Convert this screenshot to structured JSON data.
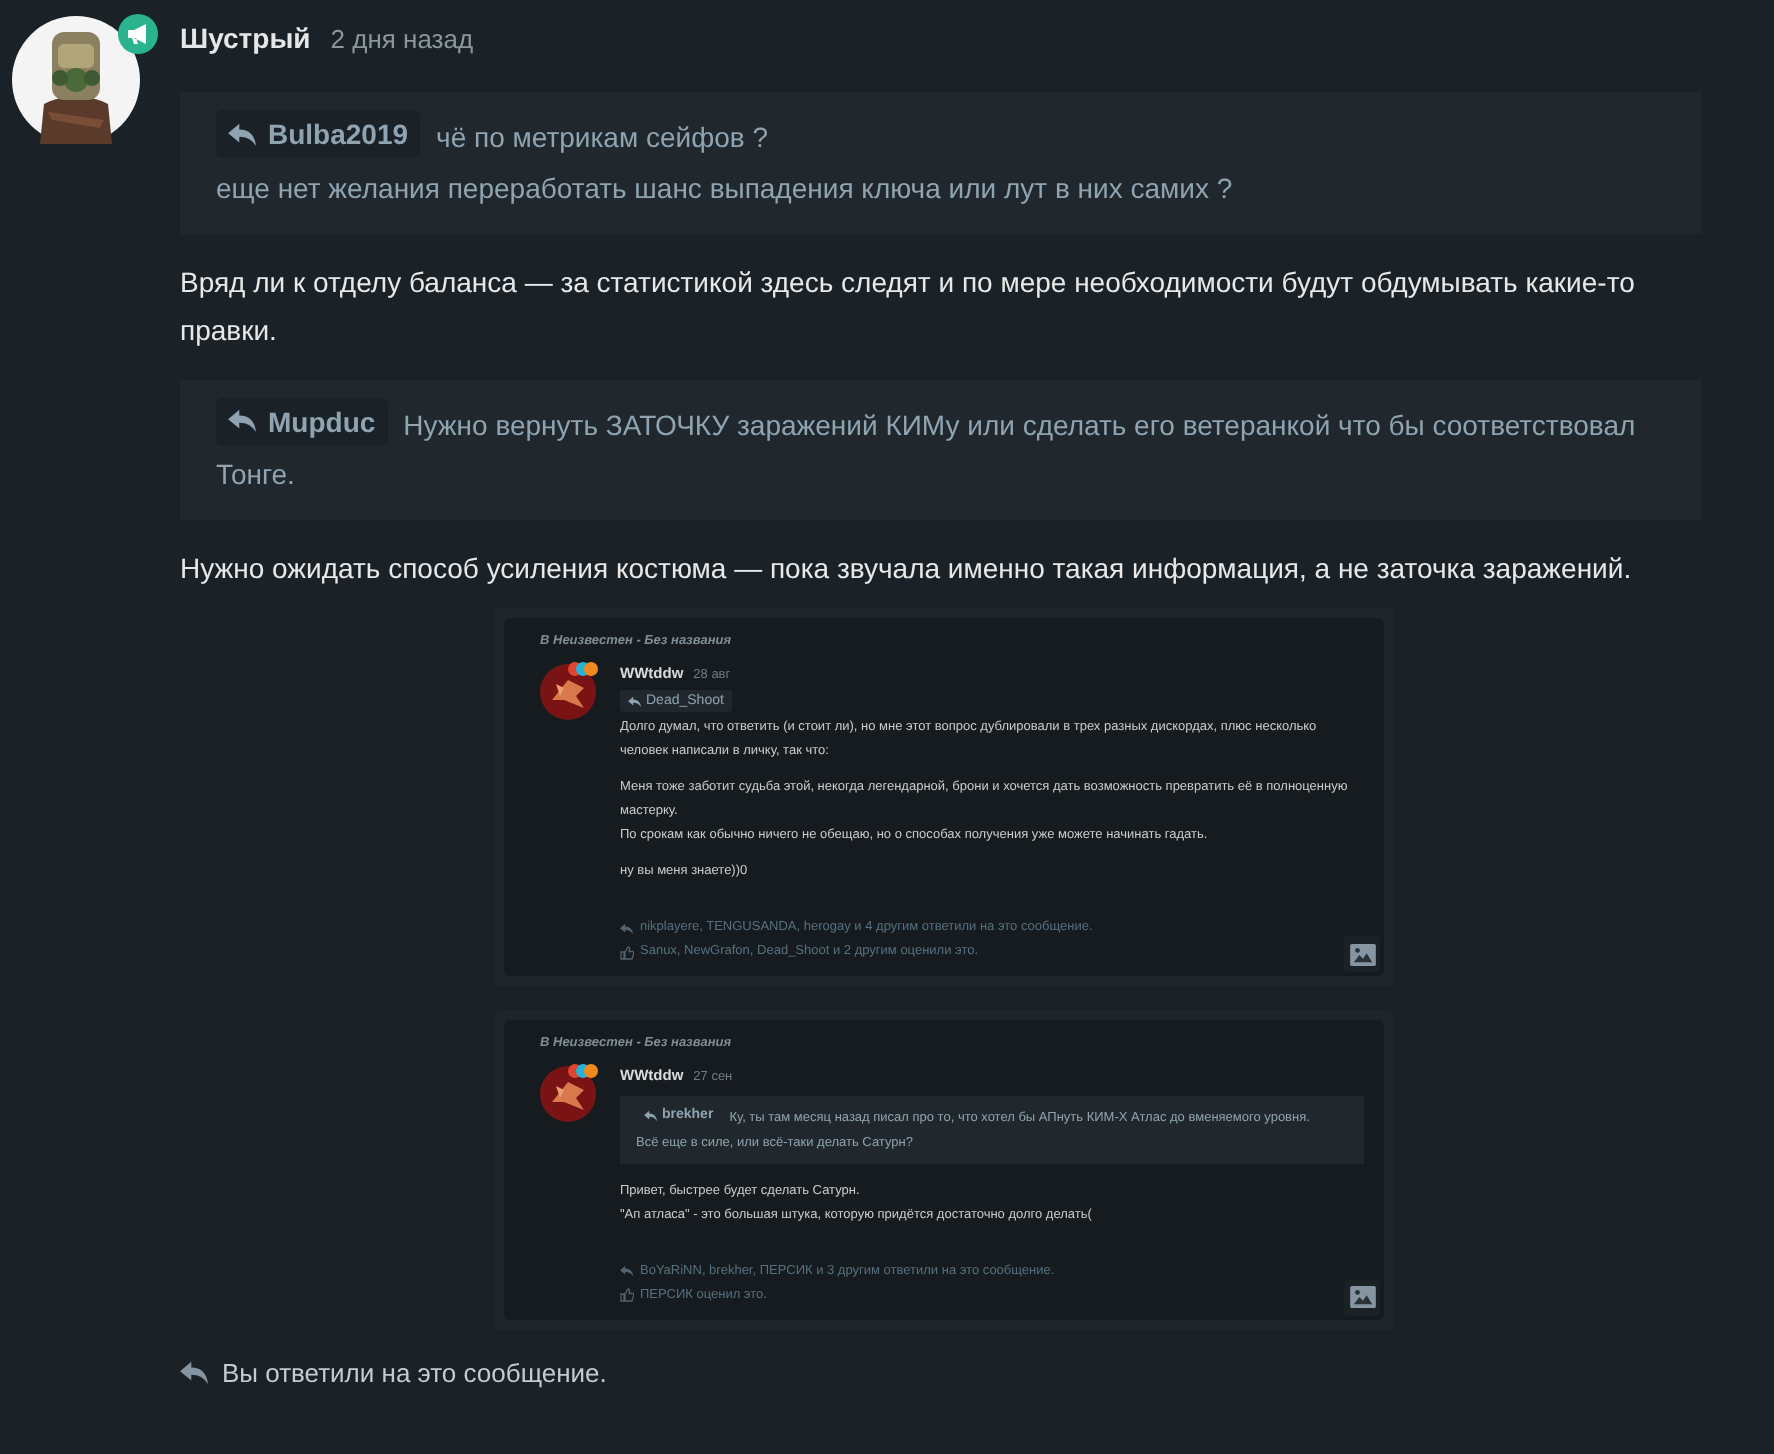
{
  "post": {
    "author": "Шустрый",
    "time": "2 дня назад"
  },
  "blocks": [
    {
      "kind": "quote",
      "user": "Bulba2019",
      "lines": [
        "чё по метрикам сейфов ?",
        "еще нет желания переработать шанс выпадения ключа или лут в них самих ?"
      ]
    },
    {
      "kind": "text",
      "text": "Вряд ли к отделу баланса — за статистикой здесь следят и по мере необходимости будут обдумывать какие-то правки."
    },
    {
      "kind": "quote",
      "user": "Mupduc",
      "lines": [
        "Нужно вернуть ЗАТОЧКУ заражений КИМу или сделать его ветеранкой что бы соответствовал",
        "Тонге."
      ]
    },
    {
      "kind": "text",
      "text": "Нужно ожидать способ усиления костюма — пока звучала именно такая информация, а не заточка заражений."
    },
    {
      "kind": "embed",
      "context": "В Неизвестен - Без названия",
      "author": "WWtddw",
      "time": "28 авг",
      "reply_to": "Dead_Shoot",
      "paragraphs": [
        [
          "Долго думал, что ответить (и стоит ли), но мне этот вопрос дублировали в трех разных дискордах, плюс несколько человек написали в личку, так что:"
        ],
        [
          "Меня тоже заботит судьба этой, некогда легендарной, брони и хочется дать возможность превратить её в полноценную мастерку.",
          "По срокам как обычно ничего не обещаю, но о способах получения уже можете начинать гадать."
        ],
        [
          "ну вы меня знаете))0"
        ]
      ],
      "replies": "nikplayere, TENGUSANDA, herogay и 4 другим ответили на это сообщение.",
      "likes": "Sanux, NewGrafon, Dead_Shoot и 2 другим оценили это."
    },
    {
      "kind": "embed",
      "context": "В Неизвестен - Без названия",
      "author": "WWtddw",
      "time": "27 сен",
      "quote": {
        "user": "brekher",
        "lines": [
          "Ку, ты там месяц назад писал про то, что хотел бы АПнуть КИМ-Х Атлас до вменяемого уровня.",
          "Всё еще в силе, или всё-таки делать Сатурн?"
        ]
      },
      "paragraphs": [
        [
          "Привет, быстрее будет сделать Сатурн.",
          "\"Ап атласа\" - это большая штука, которую придётся достаточно долго делать("
        ]
      ],
      "replies": "BoYaRiNN, brekher, ПЕРСИК и 3 другим ответили на это сообщение.",
      "likes": "ПЕРСИК оценил это."
    }
  ],
  "footer": "Вы ответили на это сообщение."
}
